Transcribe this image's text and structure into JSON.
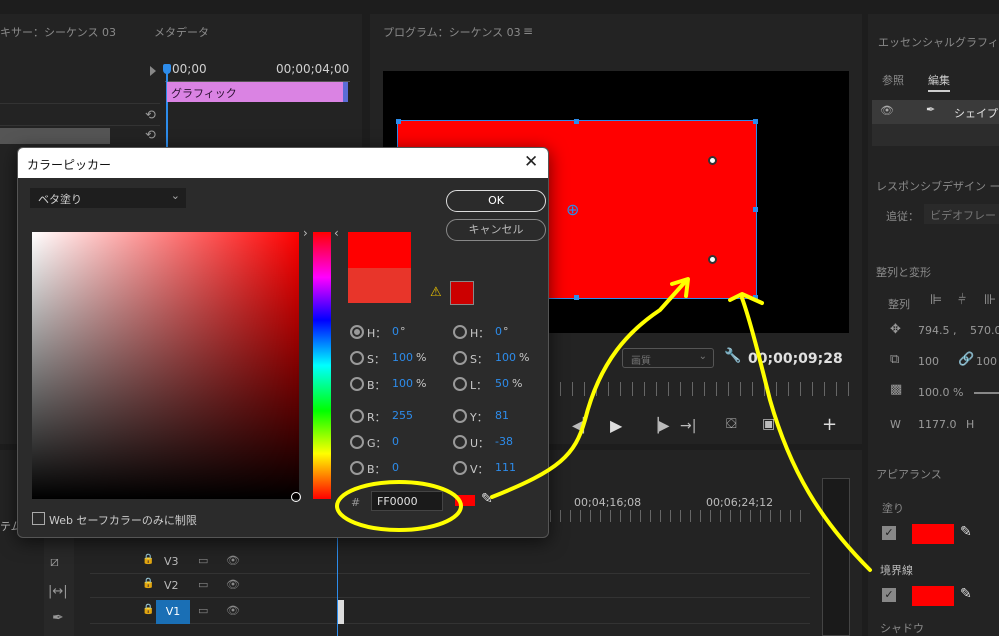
{
  "colors": {
    "accent": "#2d8ceb",
    "red": "#ff0000",
    "clip_pink": "#da83e3",
    "annotation_yellow": "#ffff00"
  },
  "source_panel": {
    "tab_mixer": "キサー：シーケンス 03",
    "tab_metadata": "メタデータ",
    "time_start": "00;00",
    "time_end": "00;00;04;00",
    "clip_label": "グラフィック"
  },
  "program_panel": {
    "title": "プログラム：シーケンス 03",
    "timecode": "00;00;09;28",
    "quality": "画質"
  },
  "essential_graphics": {
    "title": "エッセンシャルグラフィ",
    "tab_browse": "参照",
    "tab_edit": "編集",
    "layer_name": "シェイプ",
    "responsive_heading": "レスポンシブデザイン ー",
    "follow_label": "追従：",
    "follow_value": "ビデオフレー",
    "align_heading": "整列と変形",
    "align_label": "整列",
    "pos_x": "794.5 ,",
    "pos_y": "570.0",
    "scale": "100",
    "opacity": "100.0 %",
    "width_label": "W",
    "width_value": "1177.0",
    "height_label": "H",
    "appearance_heading": "アピアランス",
    "fill_label": "塗り",
    "stroke_label": "境界線",
    "shadow_label": "シャドウ"
  },
  "timeline": {
    "track_label_left": "テム",
    "tc_1": "00;04;16;08",
    "tc_2": "00;06;24;12",
    "tracks": [
      "V3",
      "V2",
      "V1"
    ]
  },
  "color_picker": {
    "title": "カラーピッカー",
    "fill_type": "ベタ塗り",
    "ok_label": "OK",
    "cancel_label": "キャンセル",
    "hsb": {
      "h_label": "H：",
      "h_value": "0",
      "h_unit": "°",
      "s_label": "S：",
      "s_value": "100",
      "s_unit": "%",
      "b_label": "B：",
      "b_value": "100",
      "b_unit": "%"
    },
    "rgb": {
      "r_label": "R：",
      "r_value": "255",
      "g_label": "G：",
      "g_value": "0",
      "b_label": "B：",
      "b_value": "0"
    },
    "hsl": {
      "h_label": "H：",
      "h_value": "0",
      "h_unit": "°",
      "s_label": "S：",
      "s_value": "100",
      "s_unit": "%",
      "l_label": "L：",
      "l_value": "50",
      "l_unit": "%"
    },
    "yuv": {
      "y_label": "Y：",
      "y_value": "81",
      "u_label": "U：",
      "u_value": "-38",
      "v_label": "V：",
      "v_value": "111"
    },
    "hex_prefix": "#",
    "hex_value": "FF0000",
    "web_safe_label": "Web セーフカラーのみに制限",
    "new_color": "#ff0000",
    "old_color": "#e8352a",
    "gamut_color": "#cc0000"
  }
}
